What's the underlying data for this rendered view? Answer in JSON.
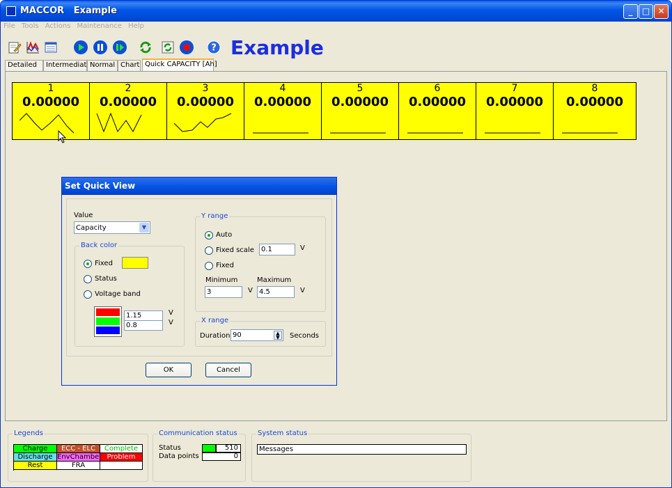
{
  "window": {
    "app_name": "MACCOR",
    "title": "Example",
    "controls": [
      "minimize",
      "maximize",
      "close"
    ]
  },
  "menu": [
    "File",
    "Tools",
    "Actions",
    "Maintenance",
    "Help"
  ],
  "toolbar": {
    "title": "Example",
    "icons": [
      "edit-icon",
      "graph-icon",
      "list-icon",
      "play-icon",
      "pause-icon",
      "resume-icon",
      "refresh-icon",
      "reload-icon",
      "record-icon",
      "help-icon"
    ]
  },
  "tabs": [
    {
      "label": "Detailed"
    },
    {
      "label": "Intermediate"
    },
    {
      "label": "Normal"
    },
    {
      "label": "Chart"
    },
    {
      "label": "Quick CAPACITY [Ah]",
      "active": true
    }
  ],
  "channels": [
    {
      "num": "1",
      "value": "0.00000"
    },
    {
      "num": "2",
      "value": "0.00000"
    },
    {
      "num": "3",
      "value": "0.00000"
    },
    {
      "num": "4",
      "value": "0.00000"
    },
    {
      "num": "5",
      "value": "0.00000"
    },
    {
      "num": "6",
      "value": "0.00000"
    },
    {
      "num": "7",
      "value": "0.00000"
    },
    {
      "num": "8",
      "value": "0.00000"
    }
  ],
  "channel_color": "#ffff00",
  "dialog": {
    "title": "Set Quick View",
    "value_label": "Value",
    "value_selected": "Capacity",
    "back_color": {
      "group_label": "Back color",
      "options": [
        "Fixed",
        "Status",
        "Voltage band"
      ],
      "selected": "Fixed",
      "fixed_color": "#ffff00",
      "band_values": [
        "1.15",
        "0.8"
      ],
      "band_unit": "V",
      "band_colors": [
        "#ff0000",
        "#00ff00",
        "#0000ff"
      ]
    },
    "y_range": {
      "group_label": "Y range",
      "options": [
        "Auto",
        "Fixed scale",
        "Fixed"
      ],
      "selected": "Auto",
      "fixed_scale_value": "0.1",
      "unit": "V",
      "minimum_label": "Minimum",
      "minimum_value": "3",
      "maximum_label": "Maximum",
      "maximum_value": "4.5"
    },
    "x_range": {
      "group_label": "X range",
      "duration_label": "Duration",
      "duration_value": "90",
      "unit": "Seconds"
    },
    "ok": "OK",
    "cancel": "Cancel"
  },
  "legends": {
    "label": "Legends",
    "rows": [
      [
        {
          "text": "Charge",
          "bg": "#00ff00",
          "fg": "#000000"
        },
        {
          "text": "ECC - ELC",
          "bg": "#c0502a",
          "fg": "#ffffff"
        },
        {
          "text": "Complete",
          "bg": "#ffffff",
          "fg": "#00c000"
        }
      ],
      [
        {
          "text": "Discharge",
          "bg": "#66e0e8",
          "fg": "#000000"
        },
        {
          "text": "EnvChamber",
          "bg": "#ff66ff",
          "fg": "#000000"
        },
        {
          "text": "Problem",
          "bg": "#ff0000",
          "fg": "#ffffff"
        }
      ],
      [
        {
          "text": "Rest",
          "bg": "#ffff00",
          "fg": "#000000"
        },
        {
          "text": "FRA",
          "bg": "#ffffff",
          "fg": "#000000"
        },
        {
          "text": "",
          "bg": "#ffffff",
          "fg": "#000000"
        }
      ]
    ]
  },
  "communication": {
    "label": "Communication status",
    "status_label": "Status",
    "status_value": "510",
    "status_color": "#00ff00",
    "datapoints_label": "Data points",
    "datapoints_value": "0"
  },
  "system": {
    "label": "System status",
    "messages": "Messages"
  }
}
